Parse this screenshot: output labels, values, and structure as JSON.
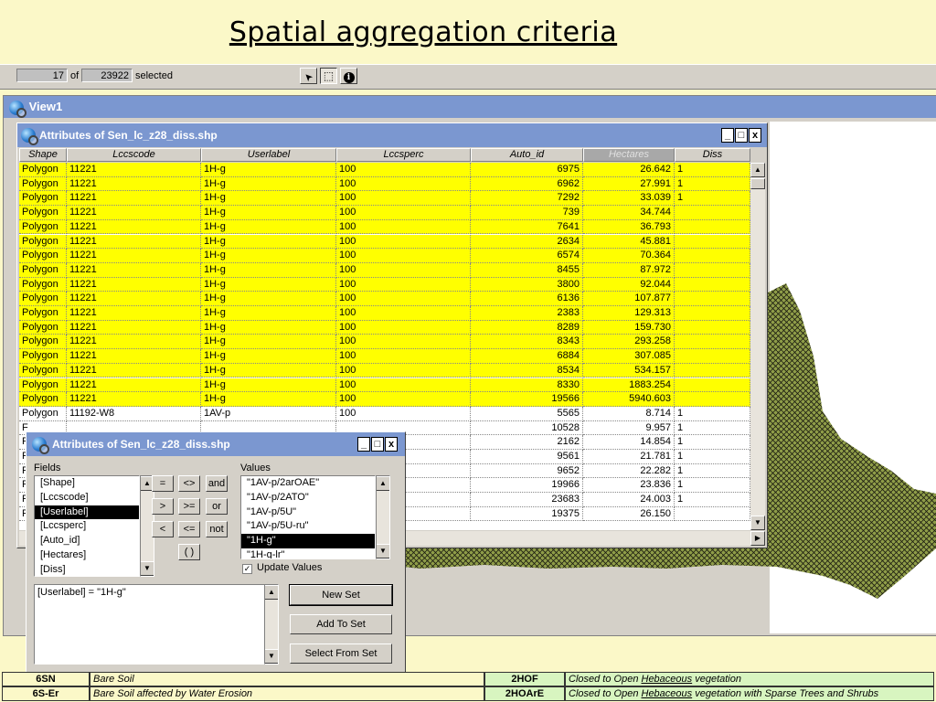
{
  "slide": {
    "title": "Spatial aggregation criteria"
  },
  "status": {
    "selected_count": "17",
    "of_label": "of",
    "total_count": "23922",
    "selected_label": "selected"
  },
  "toolbar": {
    "pointer": "➤",
    "select_tool": "⬚",
    "info": "i"
  },
  "view_window": {
    "title": "View1"
  },
  "attr_window": {
    "title": "Attributes of Sen_lc_z28_diss.shp",
    "controls": {
      "minimize": "_",
      "maximize": "□",
      "close": "x"
    },
    "columns": [
      "Shape",
      "Lccscode",
      "Userlabel",
      "Lccsperc",
      "Auto_id",
      "Hectares",
      "Diss"
    ],
    "sorted_column": "Hectares",
    "rows": [
      {
        "shape": "Polygon",
        "code": "11221",
        "label": "1H-g",
        "perc": "100",
        "auto_id": "6975",
        "ha": "26.642",
        "diss": "1",
        "sel": true
      },
      {
        "shape": "Polygon",
        "code": "11221",
        "label": "1H-g",
        "perc": "100",
        "auto_id": "6962",
        "ha": "27.991",
        "diss": "1",
        "sel": true
      },
      {
        "shape": "Polygon",
        "code": "11221",
        "label": "1H-g",
        "perc": "100",
        "auto_id": "7292",
        "ha": "33.039",
        "diss": "1",
        "sel": true
      },
      {
        "shape": "Polygon",
        "code": "11221",
        "label": "1H-g",
        "perc": "100",
        "auto_id": "739",
        "ha": "34.744",
        "diss": "",
        "sel": true
      },
      {
        "shape": "Polygon",
        "code": "11221",
        "label": "1H-g",
        "perc": "100",
        "auto_id": "7641",
        "ha": "36.793",
        "diss": "",
        "sel": true
      },
      {
        "shape": "Polygon",
        "code": "11221",
        "label": "1H-g",
        "perc": "100",
        "auto_id": "2634",
        "ha": "45.881",
        "diss": "",
        "sel": true
      },
      {
        "shape": "Polygon",
        "code": "11221",
        "label": "1H-g",
        "perc": "100",
        "auto_id": "6574",
        "ha": "70.364",
        "diss": "",
        "sel": true
      },
      {
        "shape": "Polygon",
        "code": "11221",
        "label": "1H-g",
        "perc": "100",
        "auto_id": "8455",
        "ha": "87.972",
        "diss": "",
        "sel": true
      },
      {
        "shape": "Polygon",
        "code": "11221",
        "label": "1H-g",
        "perc": "100",
        "auto_id": "3800",
        "ha": "92.044",
        "diss": "",
        "sel": true
      },
      {
        "shape": "Polygon",
        "code": "11221",
        "label": "1H-g",
        "perc": "100",
        "auto_id": "6136",
        "ha": "107.877",
        "diss": "",
        "sel": true
      },
      {
        "shape": "Polygon",
        "code": "11221",
        "label": "1H-g",
        "perc": "100",
        "auto_id": "2383",
        "ha": "129.313",
        "diss": "",
        "sel": true
      },
      {
        "shape": "Polygon",
        "code": "11221",
        "label": "1H-g",
        "perc": "100",
        "auto_id": "8289",
        "ha": "159.730",
        "diss": "",
        "sel": true
      },
      {
        "shape": "Polygon",
        "code": "11221",
        "label": "1H-g",
        "perc": "100",
        "auto_id": "8343",
        "ha": "293.258",
        "diss": "",
        "sel": true
      },
      {
        "shape": "Polygon",
        "code": "11221",
        "label": "1H-g",
        "perc": "100",
        "auto_id": "6884",
        "ha": "307.085",
        "diss": "",
        "sel": true
      },
      {
        "shape": "Polygon",
        "code": "11221",
        "label": "1H-g",
        "perc": "100",
        "auto_id": "8534",
        "ha": "534.157",
        "diss": "",
        "sel": true
      },
      {
        "shape": "Polygon",
        "code": "11221",
        "label": "1H-g",
        "perc": "100",
        "auto_id": "8330",
        "ha": "1883.254",
        "diss": "",
        "sel": true
      },
      {
        "shape": "Polygon",
        "code": "11221",
        "label": "1H-g",
        "perc": "100",
        "auto_id": "19566",
        "ha": "5940.603",
        "diss": "",
        "sel": true
      },
      {
        "shape": "Polygon",
        "code": "11192-W8",
        "label": "1AV-p",
        "perc": "100",
        "auto_id": "5565",
        "ha": "8.714",
        "diss": "1",
        "sel": false
      },
      {
        "shape": "F",
        "code": "",
        "label": "",
        "perc": "",
        "auto_id": "10528",
        "ha": "9.957",
        "diss": "1",
        "sel": false
      },
      {
        "shape": "F",
        "code": "",
        "label": "",
        "perc": "",
        "auto_id": "2162",
        "ha": "14.854",
        "diss": "1",
        "sel": false
      },
      {
        "shape": "F",
        "code": "",
        "label": "",
        "perc": "",
        "auto_id": "9561",
        "ha": "21.781",
        "diss": "1",
        "sel": false
      },
      {
        "shape": "F",
        "code": "",
        "label": "",
        "perc": "",
        "auto_id": "9652",
        "ha": "22.282",
        "diss": "1",
        "sel": false
      },
      {
        "shape": "F",
        "code": "",
        "label": "",
        "perc": "",
        "auto_id": "19966",
        "ha": "23.836",
        "diss": "1",
        "sel": false
      },
      {
        "shape": "F",
        "code": "",
        "label": "",
        "perc": "",
        "auto_id": "23683",
        "ha": "24.003",
        "diss": "1",
        "sel": false
      },
      {
        "shape": "F",
        "code": "",
        "label": "",
        "perc": "",
        "auto_id": "19375",
        "ha": "26.150",
        "diss": "",
        "sel": false
      }
    ]
  },
  "query_window": {
    "title": "Attributes of Sen_lc_z28_diss.shp",
    "controls": {
      "minimize": "_",
      "maximize": "□",
      "close": "x"
    },
    "fields_label": "Fields",
    "values_label": "Values",
    "fields": [
      "[Shape]",
      "[Lccscode]",
      "[Userlabel]",
      "[Lccsperc]",
      "[Auto_id]",
      "[Hectares]",
      "[Diss]"
    ],
    "selected_field": "[Userlabel]",
    "values": [
      "\"1AV-p/2arOAE\"",
      "\"1AV-p/2ATO\"",
      "\"1AV-p/5U\"",
      "\"1AV-p/5U-ru\"",
      "\"1H-g\"",
      "\"1H-g-lr\""
    ],
    "selected_value": "\"1H-g\"",
    "operators": [
      "=",
      "<>",
      "and",
      ">",
      ">=",
      "or",
      "<",
      "<=",
      "not",
      "( )"
    ],
    "update_values_label": "Update Values",
    "update_values_checked": "✓",
    "expression": "[Userlabel] = \"1H-g\"",
    "buttons": {
      "new_set": "New Set",
      "add_to_set": "Add To Set",
      "select_from_set": "Select From Set"
    }
  },
  "legend": {
    "rows": [
      {
        "code": "6SN",
        "desc": "Bare Soil",
        "code2": "2HOF",
        "desc2_pre": "Closed to Open ",
        "desc2_link": "Hebaceous",
        "desc2_post": " vegetation"
      },
      {
        "code": "6S-Er",
        "desc": "Bare Soil affected by Water Erosion",
        "code2": "2HOArE",
        "desc2_pre": "Closed to Open ",
        "desc2_link": "Hebaceous",
        "desc2_post": " vegetation with Sparse Trees and Shrubs"
      }
    ]
  },
  "colors": {
    "selection": "#ffff00",
    "titlebar": "#7b97d0",
    "slide_bg": "#fbf8c8",
    "map_fill": "#8a9a4a"
  }
}
